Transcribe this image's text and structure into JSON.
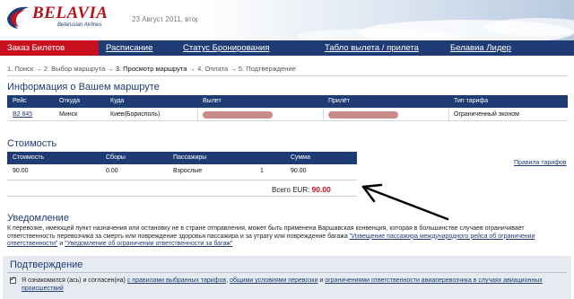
{
  "header": {
    "logo_text": "BELAVIA",
    "logo_subtitle": "Belarusian Airlines",
    "date": "23 Август 2011, вторник"
  },
  "nav": [
    {
      "label": "Заказ Билетов"
    },
    {
      "label": "Расписание"
    },
    {
      "label": "Статус Бронирования"
    },
    {
      "label": "Табло вылета / прилета"
    },
    {
      "label": "Белавиа Лидер"
    }
  ],
  "steps": {
    "s1": "1. Поиск",
    "s2": "2. Выбор маршрута",
    "s3": "3. Просмотр маршрута",
    "s4": "4. Оплата",
    "s5": "5. Подтверждение",
    "arrow": "→"
  },
  "route": {
    "title": "Информация о Вашем маршруте",
    "headers": {
      "flight": "Рейс",
      "from": "Откуда",
      "to": "Куда",
      "departure": "Вылет",
      "arrival": "Прилёт",
      "fare_type": "Тип тарифа"
    },
    "row": {
      "flight": "В2 845",
      "from": "Минск",
      "to": "Киев(Борисполь)",
      "departure": "",
      "arrival": "",
      "fare_type": "Ограниченный эконом"
    }
  },
  "cost": {
    "title": "Стоимость",
    "headers": {
      "cost": "Стоимость",
      "fees": "Сборы",
      "passengers": "Пассажиры",
      "sum": "Сумма"
    },
    "row": {
      "cost": "90.00",
      "fees": "0.00",
      "passenger_type": "Взрослые",
      "passenger_count": "1",
      "sum": "90.00"
    },
    "total_label": "Всего EUR:",
    "total_value": "90.00",
    "fare_rules_link": "Правила тарифов"
  },
  "notice": {
    "title": "Уведомление",
    "text": "К перевозке, имеющей пункт назначения или остановку не в стране отправления, может быть применена Варшавская конвенция, которая в большинстве случаев ограничивает ответственность перевозчика за смерть или повреждение здоровья пассажира и за утрату или повреждение багажа ",
    "link1": "\"Извещение пассажира международного рейса об ограничении ответственности\"",
    "and": " и ",
    "link2": "\"Уведомление об ограничении ответственности за багаж\""
  },
  "confirmation": {
    "title": "Подтверждение",
    "text_start": "Я ознакомился (ась) и согласен(на) ",
    "link1": "с правилами выбранных тарифов",
    "sep1": ", ",
    "link2": "общими условиями перевозки",
    "sep2": " и ",
    "link3": "ограничениями ответственности авиаперевозчика в случаях авиационных происшествий",
    "checked": true
  },
  "colors": {
    "brand_blue": "#1f3b73",
    "brand_red": "#c8101f",
    "redaction": "#c98a8a"
  }
}
